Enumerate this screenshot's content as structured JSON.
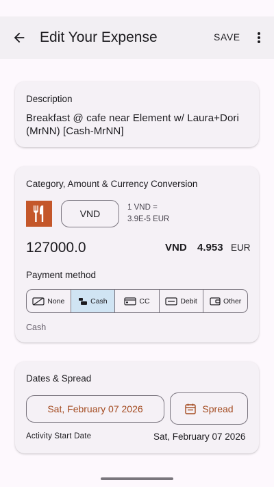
{
  "header": {
    "title": "Edit Your Expense",
    "save_label": "SAVE"
  },
  "description": {
    "label": "Description",
    "value": "Breakfast @ cafe near Element w/ Laura+Dori (MrNN) [Cash-MrNN]"
  },
  "amount_section": {
    "label": "Category, Amount & Currency Conversion",
    "category_icon": "fork-knife-icon",
    "category_color": "#c4572a",
    "currency_button": "VND",
    "rate_line_1": "1 VND =",
    "rate_line_2": "3.9E-5  EUR",
    "amount": "127000.0",
    "source_currency": "VND",
    "converted_amount": "4.953",
    "target_currency": "EUR"
  },
  "payment": {
    "label": "Payment method",
    "options": [
      {
        "label": "None",
        "icon": "none-card-icon"
      },
      {
        "label": "Cash",
        "icon": "cash-icon"
      },
      {
        "label": "CC",
        "icon": "credit-card-icon"
      },
      {
        "label": "Debit",
        "icon": "debit-card-icon"
      },
      {
        "label": "Other",
        "icon": "wallet-icon"
      }
    ],
    "selected": "Cash",
    "selected_color": "#d0e4f3",
    "status": "Cash"
  },
  "dates": {
    "label": "Dates & Spread",
    "date_button": "Sat, February 07 2026",
    "spread_button": "Spread",
    "activity_label": "Activity Start Date",
    "activity_value": "Sat, February 07 2026",
    "accent_color": "#a34a1f"
  }
}
